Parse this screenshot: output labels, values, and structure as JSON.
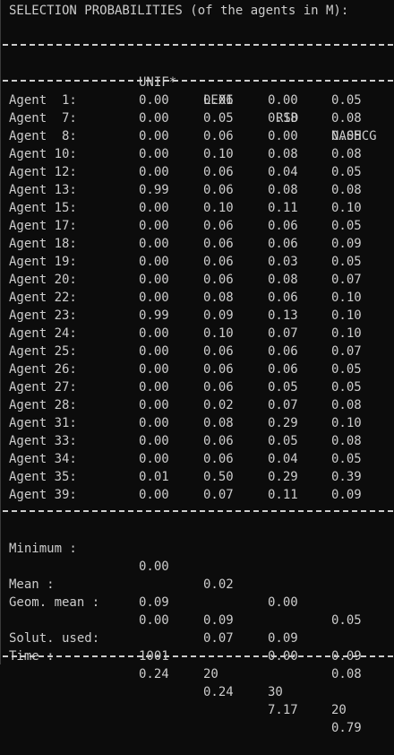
{
  "title": "SELECTION PROBABILITIES (of the agents in M):",
  "columns": [
    "UNIF*",
    "LEXI",
    "RSD",
    "NASHCG"
  ],
  "rows": [
    {
      "label": "Agent  1:",
      "values": [
        "0.00",
        "0.06",
        "0.00",
        "0.05"
      ]
    },
    {
      "label": "Agent  7:",
      "values": [
        "0.00",
        "0.05",
        "0.18",
        "0.08"
      ]
    },
    {
      "label": "Agent  8:",
      "values": [
        "0.00",
        "0.06",
        "0.00",
        "0.05"
      ]
    },
    {
      "label": "Agent 10:",
      "values": [
        "0.00",
        "0.10",
        "0.08",
        "0.08"
      ]
    },
    {
      "label": "Agent 12:",
      "values": [
        "0.00",
        "0.06",
        "0.04",
        "0.05"
      ]
    },
    {
      "label": "Agent 13:",
      "values": [
        "0.99",
        "0.06",
        "0.08",
        "0.08"
      ]
    },
    {
      "label": "Agent 15:",
      "values": [
        "0.00",
        "0.10",
        "0.11",
        "0.10"
      ]
    },
    {
      "label": "Agent 17:",
      "values": [
        "0.00",
        "0.06",
        "0.06",
        "0.05"
      ]
    },
    {
      "label": "Agent 18:",
      "values": [
        "0.00",
        "0.06",
        "0.06",
        "0.09"
      ]
    },
    {
      "label": "Agent 19:",
      "values": [
        "0.00",
        "0.06",
        "0.03",
        "0.05"
      ]
    },
    {
      "label": "Agent 20:",
      "values": [
        "0.00",
        "0.06",
        "0.08",
        "0.07"
      ]
    },
    {
      "label": "Agent 22:",
      "values": [
        "0.00",
        "0.08",
        "0.06",
        "0.10"
      ]
    },
    {
      "label": "Agent 23:",
      "values": [
        "0.99",
        "0.09",
        "0.13",
        "0.10"
      ]
    },
    {
      "label": "Agent 24:",
      "values": [
        "0.00",
        "0.10",
        "0.07",
        "0.10"
      ]
    },
    {
      "label": "Agent 25:",
      "values": [
        "0.00",
        "0.06",
        "0.06",
        "0.07"
      ]
    },
    {
      "label": "Agent 26:",
      "values": [
        "0.00",
        "0.06",
        "0.06",
        "0.05"
      ]
    },
    {
      "label": "Agent 27:",
      "values": [
        "0.00",
        "0.06",
        "0.05",
        "0.05"
      ]
    },
    {
      "label": "Agent 28:",
      "values": [
        "0.00",
        "0.02",
        "0.07",
        "0.08"
      ]
    },
    {
      "label": "Agent 31:",
      "values": [
        "0.00",
        "0.08",
        "0.29",
        "0.10"
      ]
    },
    {
      "label": "Agent 33:",
      "values": [
        "0.00",
        "0.06",
        "0.05",
        "0.08"
      ]
    },
    {
      "label": "Agent 34:",
      "values": [
        "0.00",
        "0.06",
        "0.04",
        "0.05"
      ]
    },
    {
      "label": "Agent 35:",
      "values": [
        "0.01",
        "0.50",
        "0.29",
        "0.39"
      ]
    },
    {
      "label": "Agent 39:",
      "values": [
        "0.00",
        "0.07",
        "0.11",
        "0.09"
      ]
    }
  ],
  "minimum": {
    "label": "Minimum :",
    "values": [
      "0.00",
      "0.02",
      "0.00",
      "0.05"
    ]
  },
  "mean": {
    "label": "Mean :",
    "values": [
      "0.09",
      "0.09",
      "0.09",
      "0.09"
    ]
  },
  "geom_mean": {
    "label": "Geom. mean :",
    "values": [
      "0.00",
      "0.07",
      "0.00",
      "0.08"
    ]
  },
  "solutions_used": {
    "label": "Solut. used:",
    "values": [
      "1001",
      "20",
      "30",
      "20"
    ]
  },
  "time": {
    "label": "Time :",
    "values": [
      "0.24",
      "0.24",
      "7.17",
      "0.79"
    ]
  }
}
